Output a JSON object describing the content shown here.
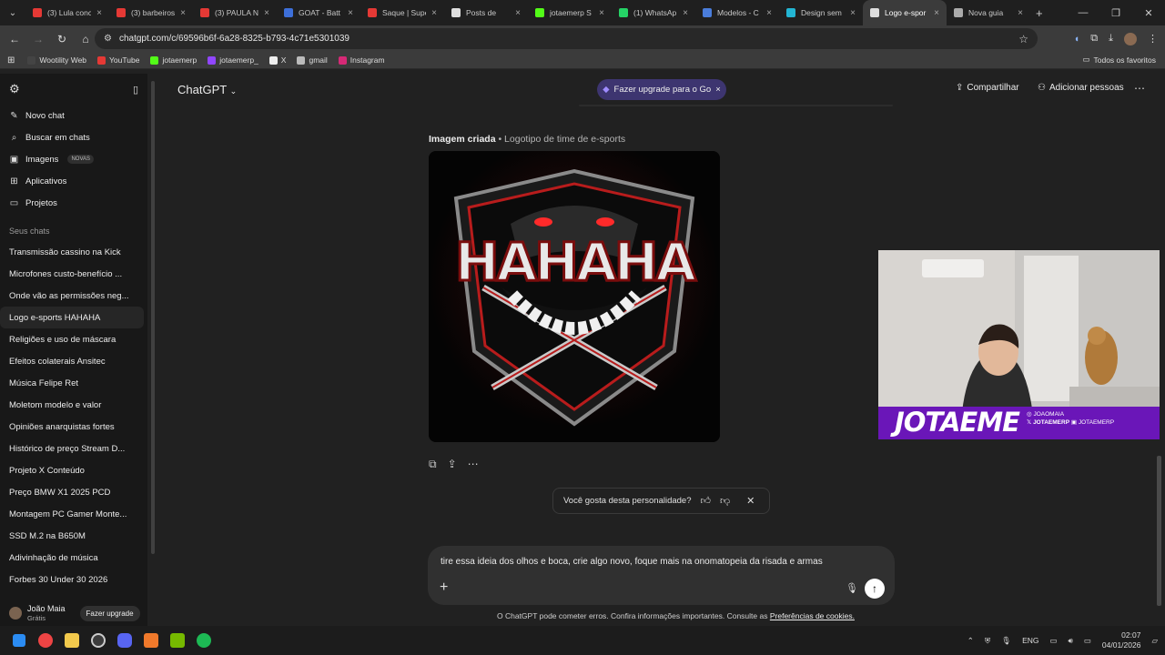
{
  "browser": {
    "tabs": [
      {
        "title": "(3) Lula conc",
        "color": "#e53935"
      },
      {
        "title": "(3) barbeiros",
        "color": "#e53935"
      },
      {
        "title": "(3) PAULA N",
        "color": "#e53935"
      },
      {
        "title": "GOAT - Batt",
        "color": "#3d6fd9"
      },
      {
        "title": "Saque | Supe",
        "color": "#e53935"
      },
      {
        "title": "Posts de",
        "color": "#dddddd"
      },
      {
        "title": "jotaemerp S",
        "color": "#53fc18"
      },
      {
        "title": "(1) WhatsAp",
        "color": "#25d366"
      },
      {
        "title": "Modelos - C",
        "color": "#4a7ddb"
      },
      {
        "title": "Design sem",
        "color": "#23b5d3"
      },
      {
        "title": "Logo e-spor",
        "color": "#dddddd"
      },
      {
        "title": "Nova guia",
        "color": "#aaaaaa"
      }
    ],
    "url": "chatgpt.com/c/69596b6f-6a28-8325-b793-4c71e5301039",
    "bookmarks": [
      {
        "label": "Wootility Web",
        "color": "#444444"
      },
      {
        "label": "YouTube",
        "color": "#e53935"
      },
      {
        "label": "jotaemerp",
        "color": "#53fc18"
      },
      {
        "label": "jotaemerp_",
        "color": "#9146ff"
      },
      {
        "label": "X",
        "color": "#eeeeee"
      },
      {
        "label": "gmail",
        "color": "#bbbbbb"
      },
      {
        "label": "Instagram",
        "color": "#d62976"
      }
    ],
    "all_bookmarks": "Todos os favoritos"
  },
  "sidebar": {
    "nav": [
      {
        "label": "Novo chat",
        "icon": "✎"
      },
      {
        "label": "Buscar em chats",
        "icon": "⌕"
      },
      {
        "label": "Imagens",
        "icon": "▣",
        "badge": "NOVAS"
      },
      {
        "label": "Aplicativos",
        "icon": "⊞"
      },
      {
        "label": "Projetos",
        "icon": "▭"
      }
    ],
    "section_title": "Seus chats",
    "chats": [
      "Transmissão cassino na Kick",
      "Microfones custo-benefício ...",
      "Onde vão as permissões neg...",
      "Logo e-sports HAHAHA",
      "Religiões e uso de máscara",
      "Efeitos colaterais Ansitec",
      "Música Felipe Ret",
      "Moletom modelo e valor",
      "Opiniões anarquistas fortes",
      "Histórico de preço Stream D...",
      "Projeto X Conteúdo",
      "Preço BMW X1 2025 PCD",
      "Montagem PC Gamer Monte...",
      "SSD M.2 na B650M",
      "Adivinhação de música",
      "Forbes 30 Under 30 2026"
    ],
    "selected_index": 3,
    "user": {
      "name": "João Maia",
      "plan": "Grátis",
      "upgrade": "Fazer upgrade"
    }
  },
  "header": {
    "model": "ChatGPT",
    "upgrade_pill": "Fazer upgrade para o Go",
    "share": "Compartilhar",
    "add_people": "Adicionar pessoas"
  },
  "conversation": {
    "image_label": "Imagem criada",
    "image_title": "• Logotipo de time de e-sports",
    "logo_text": "HAHAHA",
    "feedback_question": "Você gosta desta personalidade?"
  },
  "composer": {
    "text": "tire essa ideia dos olhos e boca, crie algo novo, foque mais na onomatopeia da risada e armas",
    "disclaimer": "O ChatGPT pode cometer erros. Confira informações importantes. Consulte as",
    "disclaimer_link": "Preferências de cookies."
  },
  "webcam": {
    "name": "JOTAEME",
    "handles": [
      "JOAOMAIA",
      "JOTAEMERP",
      "JOTAEMERP"
    ]
  },
  "taskbar": {
    "lang": "ENG",
    "time": "02:07",
    "date": "04/01/2026"
  }
}
